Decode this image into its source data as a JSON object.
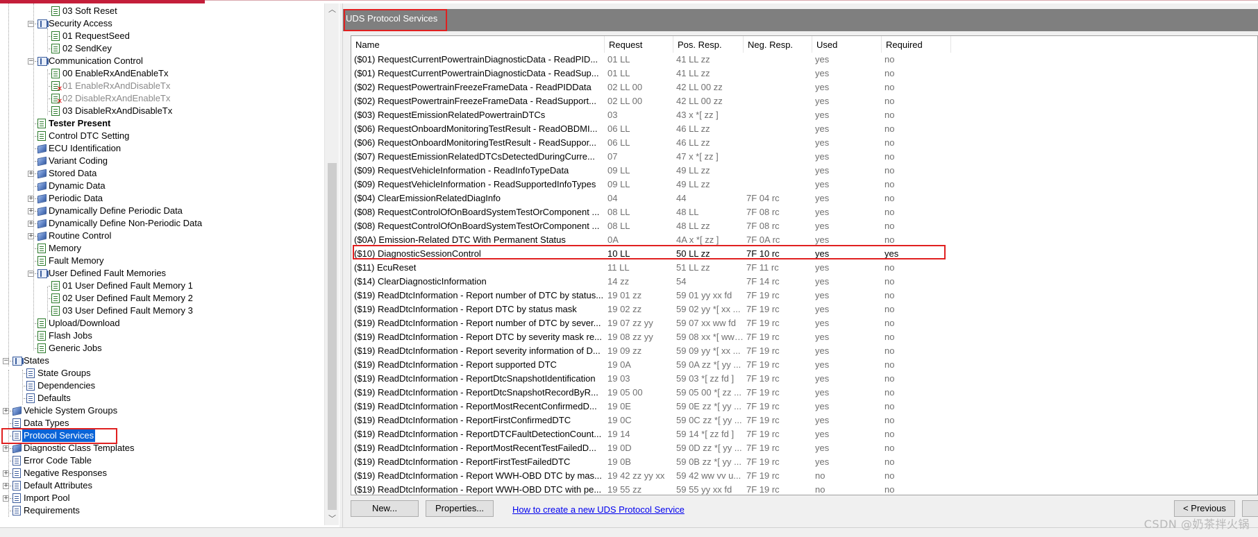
{
  "tree": {
    "items": [
      {
        "label": "03 Soft Reset"
      },
      {
        "label": "Security Access"
      },
      {
        "label": "01 RequestSeed"
      },
      {
        "label": "02 SendKey"
      },
      {
        "label": "Communication Control"
      },
      {
        "label": "00 EnableRxAndEnableTx"
      },
      {
        "label": "01 EnableRxAndDisableTx"
      },
      {
        "label": "02 DisableRxAndEnableTx"
      },
      {
        "label": "03 DisableRxAndDisableTx"
      },
      {
        "label": "Tester Present"
      },
      {
        "label": "Control DTC Setting"
      },
      {
        "label": "ECU Identification"
      },
      {
        "label": "Variant Coding"
      },
      {
        "label": "Stored Data"
      },
      {
        "label": "Dynamic Data"
      },
      {
        "label": "Periodic Data"
      },
      {
        "label": "Dynamically Define Periodic Data"
      },
      {
        "label": "Dynamically Define Non-Periodic Data"
      },
      {
        "label": "Routine Control"
      },
      {
        "label": "Memory"
      },
      {
        "label": "Fault Memory"
      },
      {
        "label": "User Defined Fault Memories"
      },
      {
        "label": "01 User Defined Fault Memory 1"
      },
      {
        "label": "02 User Defined Fault Memory 2"
      },
      {
        "label": "03 User Defined Fault Memory 3"
      },
      {
        "label": "Upload/Download"
      },
      {
        "label": "Flash Jobs"
      },
      {
        "label": "Generic Jobs"
      },
      {
        "label": "States"
      },
      {
        "label": "State Groups"
      },
      {
        "label": "Dependencies"
      },
      {
        "label": "Defaults"
      },
      {
        "label": "Vehicle System Groups"
      },
      {
        "label": "Data Types"
      },
      {
        "label": "Protocol Services"
      },
      {
        "label": "Diagnostic Class Templates"
      },
      {
        "label": "Error Code Table"
      },
      {
        "label": "Negative Responses"
      },
      {
        "label": "Default Attributes"
      },
      {
        "label": "Import Pool"
      },
      {
        "label": "Requirements"
      }
    ]
  },
  "panel": {
    "title": "UDS Protocol Services",
    "columns": [
      "Name",
      "Request",
      "Pos. Resp.",
      "Neg. Resp.",
      "Used",
      "Required"
    ],
    "rows": [
      {
        "name": "($01) RequestCurrentPowertrainDiagnosticData - ReadPID...",
        "req": "01 LL",
        "pos": "41 LL zz",
        "neg": "",
        "used": "yes",
        "required": "no"
      },
      {
        "name": "($01) RequestCurrentPowertrainDiagnosticData - ReadSup...",
        "req": "01 LL",
        "pos": "41 LL zz",
        "neg": "",
        "used": "yes",
        "required": "no"
      },
      {
        "name": "($02) RequestPowertrainFreezeFrameData - ReadPIDData",
        "req": "02 LL 00",
        "pos": "42 LL 00 zz",
        "neg": "",
        "used": "yes",
        "required": "no"
      },
      {
        "name": "($02) RequestPowertrainFreezeFrameData - ReadSupport...",
        "req": "02 LL 00",
        "pos": "42 LL 00 zz",
        "neg": "",
        "used": "yes",
        "required": "no"
      },
      {
        "name": "($03) RequestEmissionRelatedPowertrainDTCs",
        "req": "03",
        "pos": "43 x *[ zz ]",
        "neg": "",
        "used": "yes",
        "required": "no"
      },
      {
        "name": "($06) RequestOnboardMonitoringTestResult - ReadOBDMI...",
        "req": "06 LL",
        "pos": "46 LL zz",
        "neg": "",
        "used": "yes",
        "required": "no"
      },
      {
        "name": "($06) RequestOnboardMonitoringTestResult - ReadSuppor...",
        "req": "06 LL",
        "pos": "46 LL zz",
        "neg": "",
        "used": "yes",
        "required": "no"
      },
      {
        "name": "($07) RequestEmissionRelatedDTCsDetectedDuringCurre...",
        "req": "07",
        "pos": "47 x *[ zz ]",
        "neg": "",
        "used": "yes",
        "required": "no"
      },
      {
        "name": "($09) RequestVehicleInformation - ReadInfoTypeData",
        "req": "09 LL",
        "pos": "49 LL zz",
        "neg": "",
        "used": "yes",
        "required": "no"
      },
      {
        "name": "($09) RequestVehicleInformation - ReadSupportedInfoTypes",
        "req": "09 LL",
        "pos": "49 LL zz",
        "neg": "",
        "used": "yes",
        "required": "no"
      },
      {
        "name": "($04) ClearEmissionRelatedDiagInfo",
        "req": "04",
        "pos": "44",
        "neg": "7F 04 rc",
        "used": "yes",
        "required": "no"
      },
      {
        "name": "($08) RequestControlOfOnBoardSystemTestOrComponent ...",
        "req": "08 LL",
        "pos": "48 LL",
        "neg": "7F 08 rc",
        "used": "yes",
        "required": "no"
      },
      {
        "name": "($08) RequestControlOfOnBoardSystemTestOrComponent ...",
        "req": "08 LL",
        "pos": "48 LL zz",
        "neg": "7F 08 rc",
        "used": "yes",
        "required": "no"
      },
      {
        "name": "($0A) Emission-Related DTC With Permanent Status",
        "req": "0A",
        "pos": "4A x *[ zz ]",
        "neg": "7F 0A rc",
        "used": "yes",
        "required": "no"
      },
      {
        "name": "($10) DiagnosticSessionControl",
        "req": "10 LL",
        "pos": "50 LL zz",
        "neg": "7F 10 rc",
        "used": "yes",
        "required": "yes"
      },
      {
        "name": "($11) EcuReset",
        "req": "11 LL",
        "pos": "51 LL zz",
        "neg": "7F 11 rc",
        "used": "yes",
        "required": "no"
      },
      {
        "name": "($14) ClearDiagnosticInformation",
        "req": "14 zz",
        "pos": "54",
        "neg": "7F 14 rc",
        "used": "yes",
        "required": "no"
      },
      {
        "name": "($19) ReadDtcInformation - Report number of DTC by status...",
        "req": "19 01 zz",
        "pos": "59 01 yy xx fd",
        "neg": "7F 19 rc",
        "used": "yes",
        "required": "no"
      },
      {
        "name": "($19) ReadDtcInformation - Report DTC by status mask",
        "req": "19 02 zz",
        "pos": "59 02 yy *[ xx ...",
        "neg": "7F 19 rc",
        "used": "yes",
        "required": "no"
      },
      {
        "name": "($19) ReadDtcInformation - Report number of DTC by sever...",
        "req": "19 07 zz yy",
        "pos": "59 07 xx ww fd",
        "neg": "7F 19 rc",
        "used": "yes",
        "required": "no"
      },
      {
        "name": "($19) ReadDtcInformation - Report DTC by severity mask re...",
        "req": "19 08 zz yy",
        "pos": "59 08 xx *[ ww ...",
        "neg": "7F 19 rc",
        "used": "yes",
        "required": "no"
      },
      {
        "name": "($19) ReadDtcInformation - Report severity information of D...",
        "req": "19 09 zz",
        "pos": "59 09 yy *[ xx ...",
        "neg": "7F 19 rc",
        "used": "yes",
        "required": "no"
      },
      {
        "name": "($19) ReadDtcInformation - Report supported DTC",
        "req": "19 0A",
        "pos": "59 0A zz *[ yy ...",
        "neg": "7F 19 rc",
        "used": "yes",
        "required": "no"
      },
      {
        "name": "($19) ReadDtcInformation - ReportDtcSnapshotIdentification",
        "req": "19 03",
        "pos": "59 03 *[ zz fd ]",
        "neg": "7F 19 rc",
        "used": "yes",
        "required": "no"
      },
      {
        "name": "($19) ReadDtcInformation - ReportDtcSnapshotRecordByR...",
        "req": "19 05 00",
        "pos": "59 05 00 *[ zz ...",
        "neg": "7F 19 rc",
        "used": "yes",
        "required": "no"
      },
      {
        "name": "($19) ReadDtcInformation - ReportMostRecentConfirmedD...",
        "req": "19 0E",
        "pos": "59 0E zz *[ yy ...",
        "neg": "7F 19 rc",
        "used": "yes",
        "required": "no"
      },
      {
        "name": "($19) ReadDtcInformation - ReportFirstConfirmedDTC",
        "req": "19 0C",
        "pos": "59 0C zz *[ yy ...",
        "neg": "7F 19 rc",
        "used": "yes",
        "required": "no"
      },
      {
        "name": "($19) ReadDtcInformation - ReportDTCFaultDetectionCount...",
        "req": "19 14",
        "pos": "59 14 *[ zz fd ]",
        "neg": "7F 19 rc",
        "used": "yes",
        "required": "no"
      },
      {
        "name": "($19) ReadDtcInformation - ReportMostRecentTestFailedD...",
        "req": "19 0D",
        "pos": "59 0D zz *[ yy ...",
        "neg": "7F 19 rc",
        "used": "yes",
        "required": "no"
      },
      {
        "name": "($19) ReadDtcInformation - ReportFirstTestFailedDTC",
        "req": "19 0B",
        "pos": "59 0B zz *[ yy ...",
        "neg": "7F 19 rc",
        "used": "yes",
        "required": "no"
      },
      {
        "name": "($19) ReadDtcInformation - Report WWH-OBD DTC by mas...",
        "req": "19 42 zz yy xx",
        "pos": "59 42 ww vv u...",
        "neg": "7F 19 rc",
        "used": "no",
        "required": "no"
      },
      {
        "name": "($19) ReadDtcInformation - Report WWH-OBD DTC with pe...",
        "req": "19 55 zz",
        "pos": "59 55 yy xx fd",
        "neg": "7F 19 rc",
        "used": "no",
        "required": "no"
      }
    ]
  },
  "buttons": {
    "new": "New...",
    "properties": "Properties...",
    "help_link": "How to create a new UDS Protocol Service",
    "previous": "< Previous"
  },
  "watermark": "CSDN @奶茶拌火锅",
  "colors": {
    "highlight_red": "#e02020",
    "header_gray": "#7f7f7f",
    "selection_blue": "#0a64d8"
  }
}
